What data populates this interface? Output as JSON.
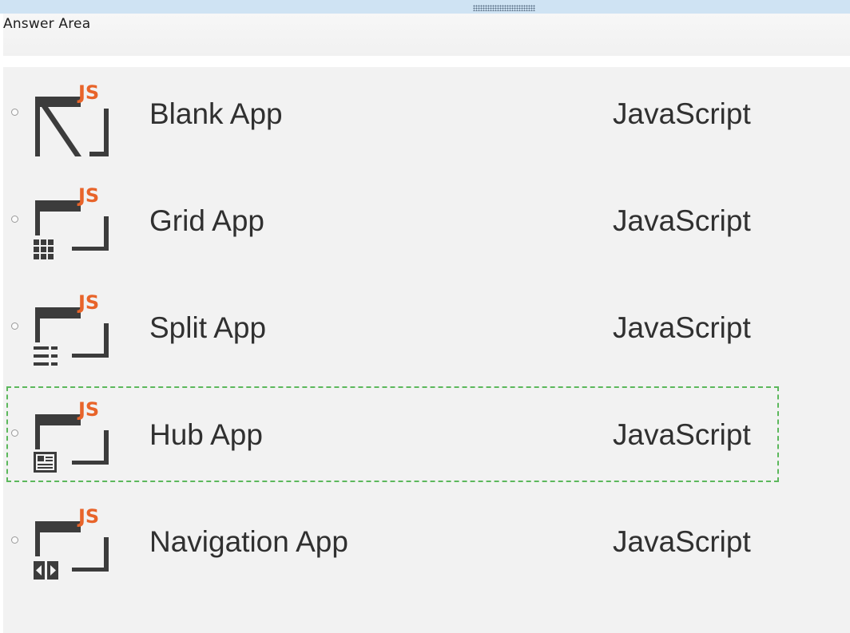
{
  "answer_area": {
    "title": "Answer Area"
  },
  "options": [
    {
      "name": "Blank App",
      "language": "JavaScript",
      "icon": "blank-app-template-icon",
      "badge": "JS"
    },
    {
      "name": "Grid App",
      "language": "JavaScript",
      "icon": "grid-app-template-icon",
      "badge": "JS"
    },
    {
      "name": "Split App",
      "language": "JavaScript",
      "icon": "split-app-template-icon",
      "badge": "JS"
    },
    {
      "name": "Hub App",
      "language": "JavaScript",
      "icon": "hub-app-template-icon",
      "badge": "JS"
    },
    {
      "name": "Navigation App",
      "language": "JavaScript",
      "icon": "navigation-app-template-icon",
      "badge": "JS"
    }
  ],
  "colors": {
    "top_bar": "#cfe3f3",
    "panel_background": "#f2f2f2",
    "js_badge": "#e8642a",
    "icon_dark": "#3c3c3c",
    "highlight_dash": "#5cb85c",
    "text": "#303030"
  }
}
